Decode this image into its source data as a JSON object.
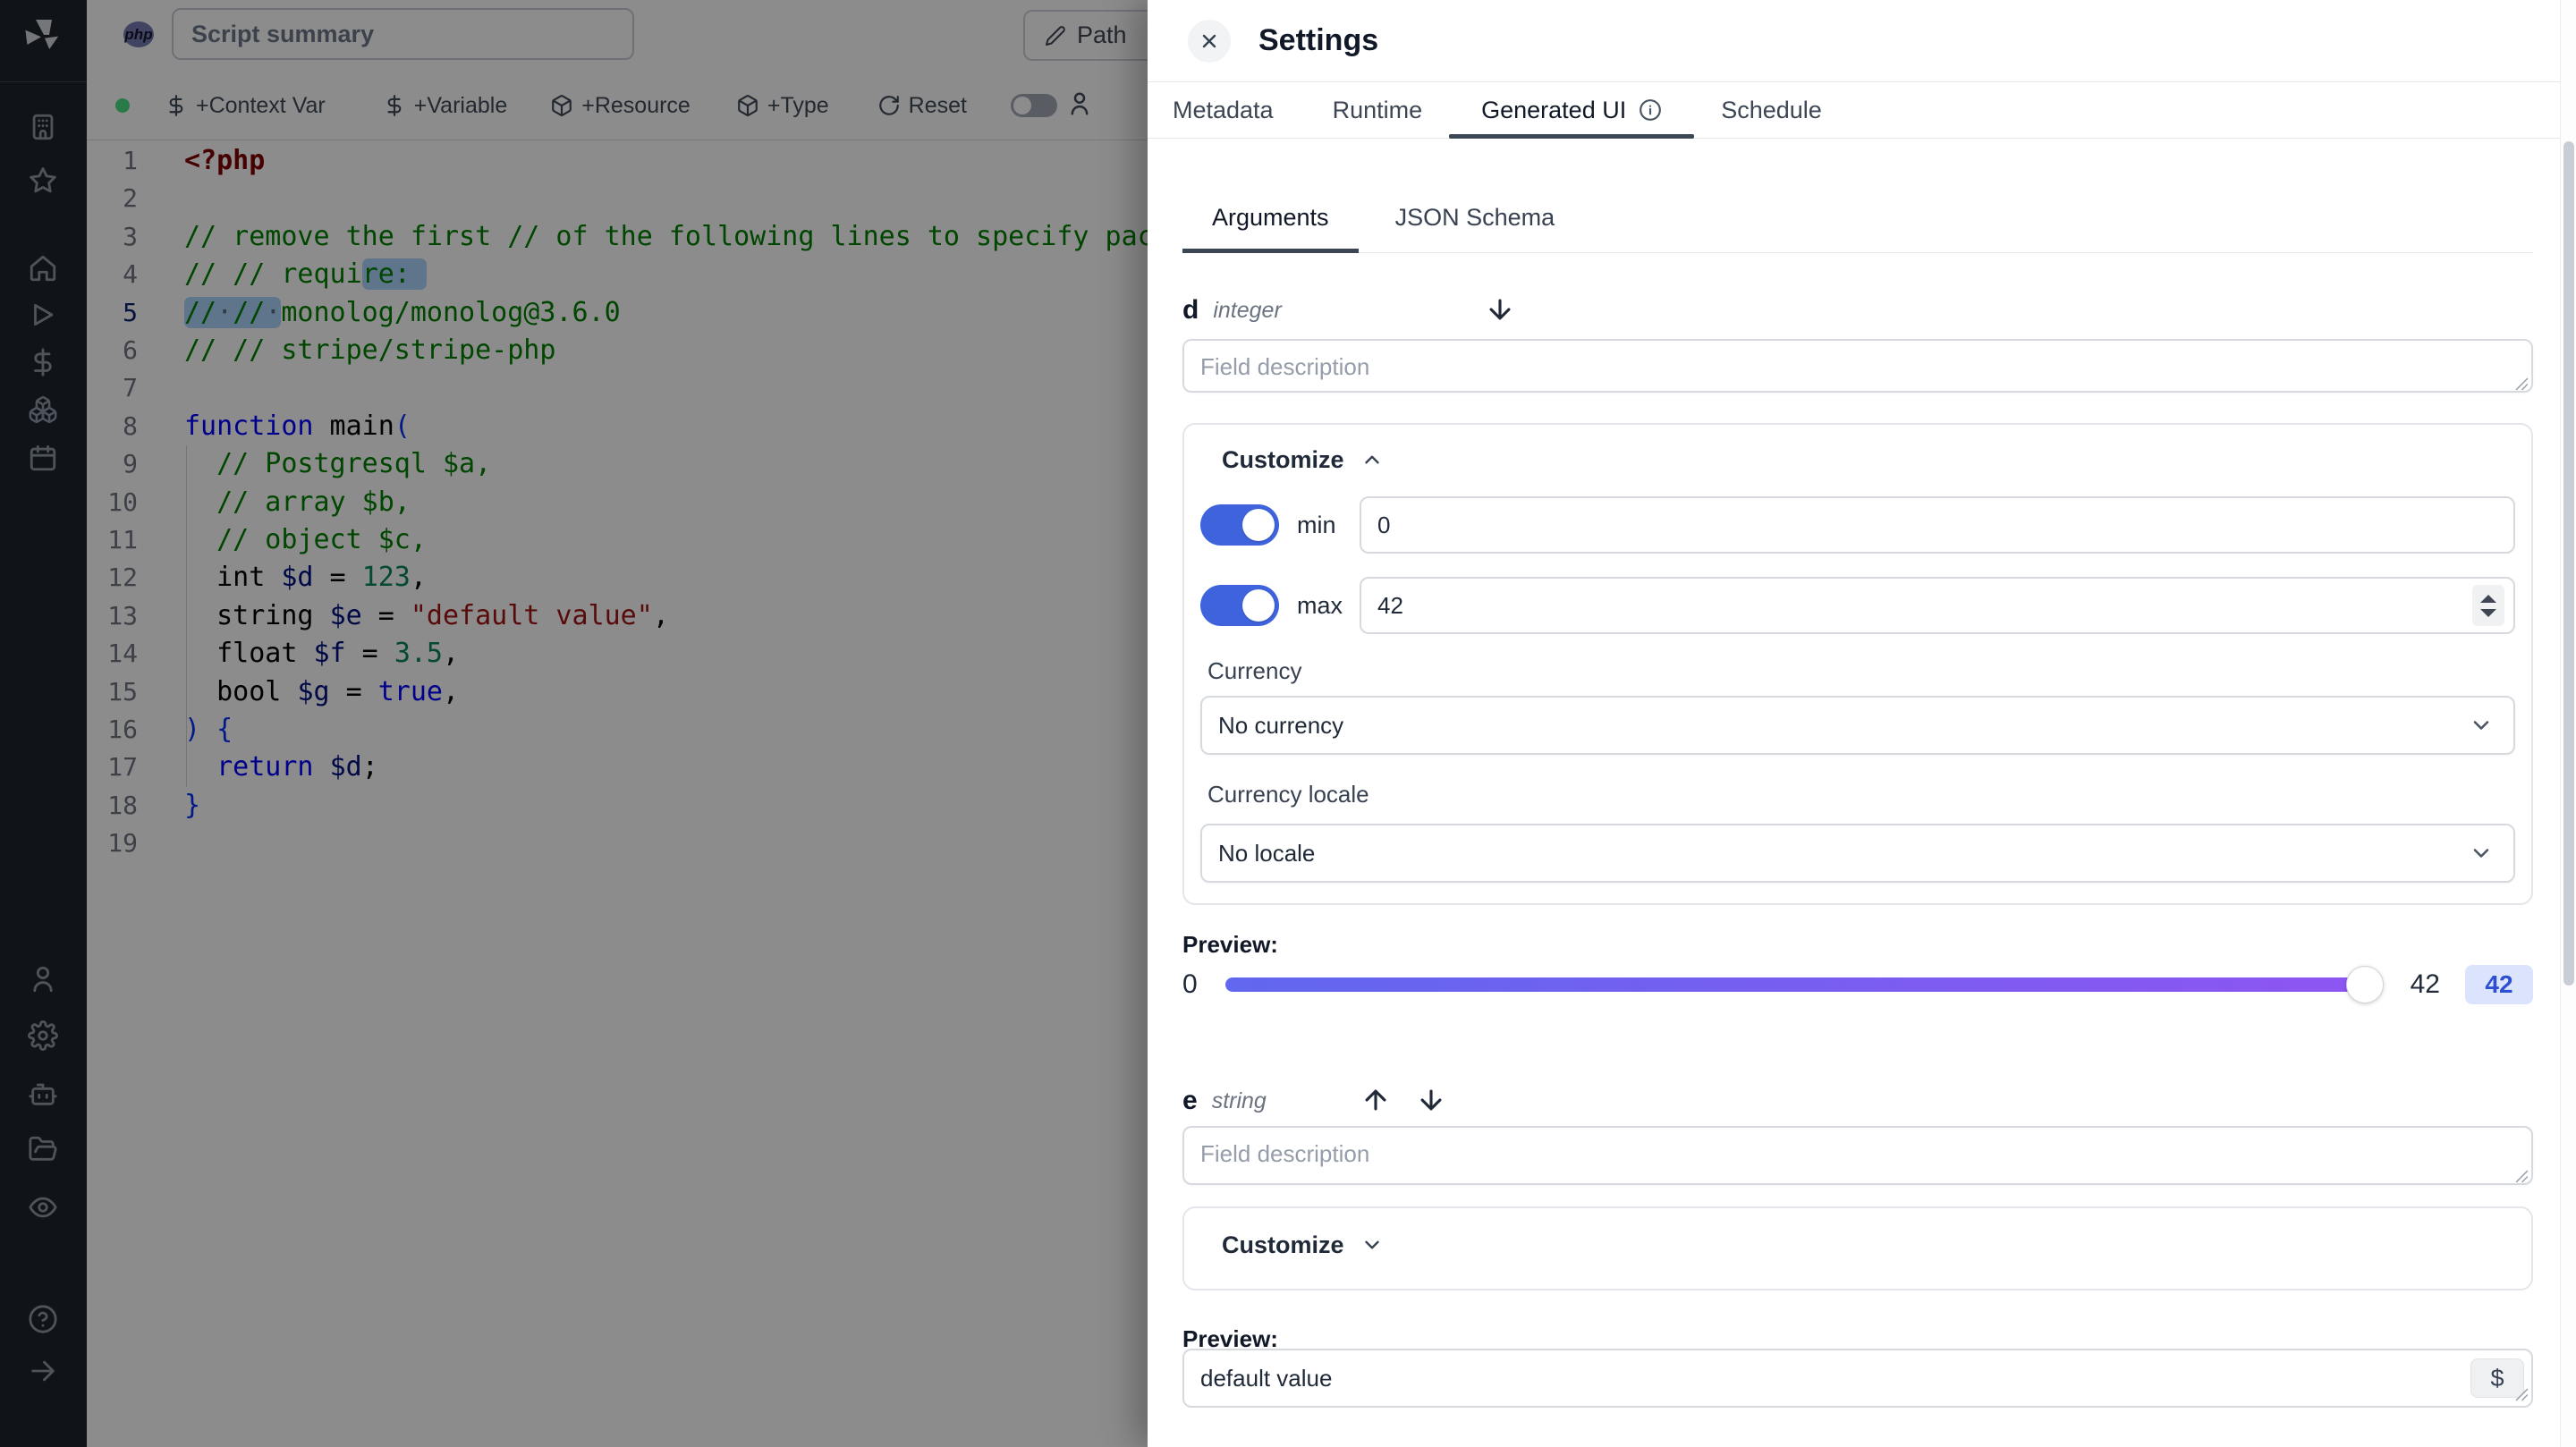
{
  "header": {
    "language_badge": "php",
    "summary_placeholder": "Script summary",
    "path_label": "Path"
  },
  "toolbar": {
    "context_var_label": "+Context Var",
    "variable_label": "+Variable",
    "resource_label": "+Resource",
    "type_label": "+Type",
    "reset_label": "Reset"
  },
  "sidebar": {
    "icons": [
      "windmill-logo",
      "building",
      "star",
      "home",
      "play",
      "dollar",
      "boxes",
      "calendar",
      "user",
      "gear",
      "robot",
      "folder-open",
      "eye",
      "help-circle",
      "arrow-right"
    ]
  },
  "editor": {
    "language": "php",
    "lines": [
      {
        "n": "1",
        "tokens": [
          {
            "c": "tag",
            "t": "<?php"
          }
        ]
      },
      {
        "n": "2",
        "tokens": []
      },
      {
        "n": "3",
        "tokens": [
          {
            "c": "comment",
            "t": "// remove the first // of the following lines to specify packages to install"
          }
        ]
      },
      {
        "n": "4",
        "tokens": [
          {
            "c": "comment",
            "t": "// // requi"
          },
          {
            "c": "comment sel sel-start sel-end",
            "t": "re: "
          }
        ]
      },
      {
        "n": "5",
        "active": true,
        "tokens": [
          {
            "c": "comment sel sel-start",
            "t": "//"
          },
          {
            "c": "ws sel",
            "t": "·"
          },
          {
            "c": "comment sel",
            "t": "//"
          },
          {
            "c": "ws sel sel-end",
            "t": "·"
          },
          {
            "c": "comment",
            "t": "monolog/monolog@3.6.0"
          }
        ]
      },
      {
        "n": "6",
        "tokens": [
          {
            "c": "comment",
            "t": "// // stripe/stripe-php"
          }
        ]
      },
      {
        "n": "7",
        "tokens": []
      },
      {
        "n": "8",
        "tokens": [
          {
            "c": "keyword",
            "t": "function"
          },
          {
            "c": "plain",
            "t": " main"
          },
          {
            "c": "bracket",
            "t": "("
          }
        ]
      },
      {
        "n": "9",
        "tokens": [
          {
            "c": "comment",
            "t": "  // Postgresql $a,"
          }
        ]
      },
      {
        "n": "10",
        "tokens": [
          {
            "c": "comment",
            "t": "  // array $b,"
          }
        ]
      },
      {
        "n": "11",
        "tokens": [
          {
            "c": "comment",
            "t": "  // object $c,"
          }
        ]
      },
      {
        "n": "12",
        "tokens": [
          {
            "c": "plain",
            "t": "  int "
          },
          {
            "c": "var",
            "t": "$d"
          },
          {
            "c": "plain",
            "t": " = "
          },
          {
            "c": "num",
            "t": "123"
          },
          {
            "c": "plain",
            "t": ","
          }
        ]
      },
      {
        "n": "13",
        "tokens": [
          {
            "c": "plain",
            "t": "  string "
          },
          {
            "c": "var",
            "t": "$e"
          },
          {
            "c": "plain",
            "t": " = "
          },
          {
            "c": "str",
            "t": "\"default value\""
          },
          {
            "c": "plain",
            "t": ","
          }
        ]
      },
      {
        "n": "14",
        "tokens": [
          {
            "c": "plain",
            "t": "  float "
          },
          {
            "c": "var",
            "t": "$f"
          },
          {
            "c": "plain",
            "t": " = "
          },
          {
            "c": "num",
            "t": "3.5"
          },
          {
            "c": "plain",
            "t": ","
          }
        ]
      },
      {
        "n": "15",
        "tokens": [
          {
            "c": "plain",
            "t": "  bool "
          },
          {
            "c": "var",
            "t": "$g"
          },
          {
            "c": "plain",
            "t": " = "
          },
          {
            "c": "keyword",
            "t": "true"
          },
          {
            "c": "plain",
            "t": ","
          }
        ]
      },
      {
        "n": "16",
        "tokens": [
          {
            "c": "bracket",
            "t": ") {"
          }
        ]
      },
      {
        "n": "17",
        "tokens": [
          {
            "c": "plain",
            "t": "  "
          },
          {
            "c": "keyword",
            "t": "return"
          },
          {
            "c": "plain",
            "t": " "
          },
          {
            "c": "var",
            "t": "$d"
          },
          {
            "c": "plain",
            "t": ";"
          }
        ]
      },
      {
        "n": "18",
        "tokens": [
          {
            "c": "bracket",
            "t": "}"
          }
        ]
      },
      {
        "n": "19",
        "tokens": []
      }
    ]
  },
  "settings": {
    "title": "Settings",
    "tabs": {
      "metadata": "Metadata",
      "runtime": "Runtime",
      "generated_ui": "Generated UI",
      "schedule": "Schedule"
    },
    "subtabs": {
      "arguments": "Arguments",
      "json_schema": "JSON Schema"
    },
    "field_d": {
      "name": "d",
      "type": "integer",
      "description_placeholder": "Field description",
      "customize_label": "Customize",
      "min_label": "min",
      "min_value": "0",
      "max_label": "max",
      "max_value": "42",
      "currency_label": "Currency",
      "currency_value": "No currency",
      "locale_label": "Currency locale",
      "locale_value": "No locale",
      "preview_label": "Preview:",
      "slider_min": "0",
      "slider_value": "42",
      "badge_value": "42"
    },
    "field_e": {
      "name": "e",
      "type": "string",
      "description_placeholder": "Field description",
      "customize_label": "Customize",
      "preview_label": "Preview:",
      "value": "default value",
      "dollar_button": "$"
    }
  },
  "colors": {
    "toggle_on": "#3e63dd",
    "toolbar_toggle_off": "#a3aab4",
    "status_dot": "#4ade80",
    "slider_gradient_from": "#6167ef",
    "slider_gradient_to": "#8e55f2",
    "badge_bg": "#dbe4fc",
    "badge_text": "#2e4fd0",
    "php_badge": "#777bb3",
    "selection": "#add6ff",
    "sidebar_bg": "#1e232c"
  }
}
